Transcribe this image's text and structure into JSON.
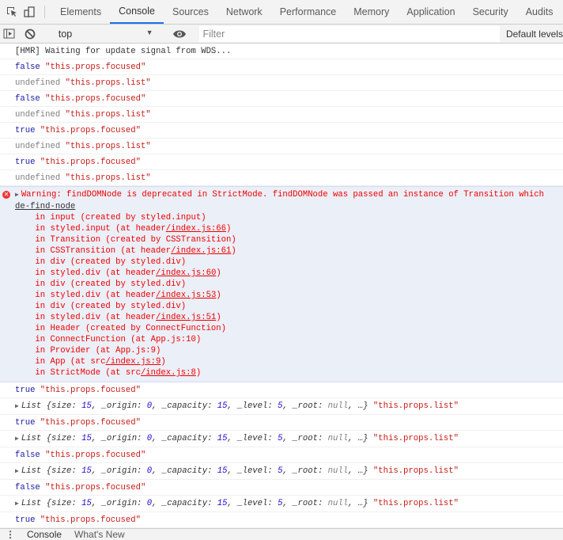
{
  "tabs": [
    "Elements",
    "Console",
    "Sources",
    "Network",
    "Performance",
    "Memory",
    "Application",
    "Security",
    "Audits"
  ],
  "active_tab": "Console",
  "toolbar": {
    "context": "top",
    "filter_placeholder": "Filter",
    "levels": "Default levels"
  },
  "colors": {
    "accent": "#1a73e8",
    "boolean": "#1a1aa6",
    "string": "#c41a16",
    "error_text": "#e00000",
    "error_bg": "#ebeff8"
  },
  "messages": [
    {
      "type": "text",
      "text": "[HMR] Waiting for update signal from WDS..."
    },
    {
      "type": "pair",
      "value": "false",
      "label": "\"this.props.focused\""
    },
    {
      "type": "undef",
      "value": "undefined",
      "label": "\"this.props.list\""
    },
    {
      "type": "pair",
      "value": "false",
      "label": "\"this.props.focused\""
    },
    {
      "type": "undef",
      "value": "undefined",
      "label": "\"this.props.list\""
    },
    {
      "type": "pair",
      "value": "true",
      "label": "\"this.props.focused\""
    },
    {
      "type": "undef",
      "value": "undefined",
      "label": "\"this.props.list\""
    },
    {
      "type": "pair",
      "value": "true",
      "label": "\"this.props.focused\""
    },
    {
      "type": "undef",
      "value": "undefined",
      "label": "\"this.props.list\""
    }
  ],
  "error": {
    "first": "Warning: findDOMNode is deprecated in StrictMode. findDOMNode was passed an instance of Transition which",
    "link": "de-find-node",
    "stack": [
      [
        "    in input (created by styled.input)",
        ""
      ],
      [
        "    in styled.input (at header",
        "/index.js:66",
        ")"
      ],
      [
        "    in Transition (created by CSSTransition)",
        ""
      ],
      [
        "    in CSSTransition (at header",
        "/index.js:61",
        ")"
      ],
      [
        "    in div (created by styled.div)",
        ""
      ],
      [
        "    in styled.div (at header",
        "/index.js:60",
        ")"
      ],
      [
        "    in div (created by styled.div)",
        ""
      ],
      [
        "    in styled.div (at header",
        "/index.js:53",
        ")"
      ],
      [
        "    in div (created by styled.div)",
        ""
      ],
      [
        "    in styled.div (at header",
        "/index.js:51",
        ")"
      ],
      [
        "    in Header (created by ConnectFunction)",
        ""
      ],
      [
        "    in ConnectFunction (at App.js:10)",
        ""
      ],
      [
        "    in Provider (at App.js:9)",
        ""
      ],
      [
        "    in App (at src",
        "/index.js:9",
        ")"
      ],
      [
        "    in StrictMode (at src",
        "/index.js:8",
        ")"
      ]
    ]
  },
  "after": [
    {
      "type": "pair",
      "value": "true",
      "label": "\"this.props.focused\""
    },
    {
      "type": "list",
      "label": "\"this.props.list\""
    },
    {
      "type": "pair",
      "value": "true",
      "label": "\"this.props.focused\""
    },
    {
      "type": "list",
      "label": "\"this.props.list\""
    },
    {
      "type": "pair",
      "value": "false",
      "label": "\"this.props.focused\""
    },
    {
      "type": "list",
      "label": "\"this.props.list\""
    },
    {
      "type": "pair",
      "value": "false",
      "label": "\"this.props.focused\""
    },
    {
      "type": "list",
      "label": "\"this.props.list\""
    },
    {
      "type": "pair",
      "value": "true",
      "label": "\"this.props.focused\""
    }
  ],
  "list_obj": {
    "name": "List",
    "size": "15",
    "origin": "0",
    "capacity": "15",
    "level": "5",
    "root": "null"
  },
  "drawer": {
    "tabs": [
      "Console",
      "What's New"
    ]
  }
}
